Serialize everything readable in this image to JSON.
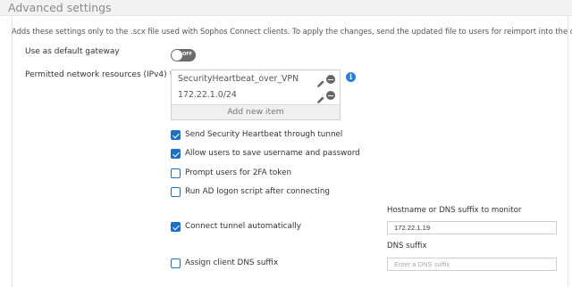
{
  "header": {
    "title": "Advanced settings"
  },
  "description": "Adds these settings only to the .scx file used with Sophos Connect clients. To apply the changes, send the updated file to users for reimport into the client",
  "default_gateway": {
    "label": "Use as default gateway",
    "toggle_state": "OFF"
  },
  "network_resources": {
    "label": "Permitted network resources (IPv4) *",
    "items": [
      {
        "text": "SecurityHeartbeat_over_VPN",
        "edit_icon": "pencil-icon",
        "remove_icon": "minus-circle-icon"
      },
      {
        "text": "172.22.1.0/24",
        "edit_icon": "pencil-icon",
        "remove_icon": "minus-circle-icon"
      }
    ],
    "add_new_label": "Add new item",
    "info_icon": "info-icon",
    "info_glyph": "i"
  },
  "options": [
    {
      "label": "Send Security Heartbeat through tunnel",
      "checked": true
    },
    {
      "label": "Allow users to save username and password",
      "checked": true
    },
    {
      "label": "Prompt users for 2FA token",
      "checked": false
    },
    {
      "label": "Run AD logon script after connecting",
      "checked": false
    },
    {
      "label": "Connect tunnel automatically",
      "checked": true
    },
    {
      "label": "Assign client DNS suffix",
      "checked": false
    }
  ],
  "hostname_monitor": {
    "label": "Hostname or DNS suffix to monitor",
    "value": "172.22.1.19"
  },
  "dns_suffix": {
    "label": "DNS suffix",
    "placeholder": "Enter a DNS suffix",
    "value": ""
  },
  "colors": {
    "accent": "#1f6fc5",
    "info": "#2a7fd4",
    "toggle_off": "#6b6b6b"
  }
}
